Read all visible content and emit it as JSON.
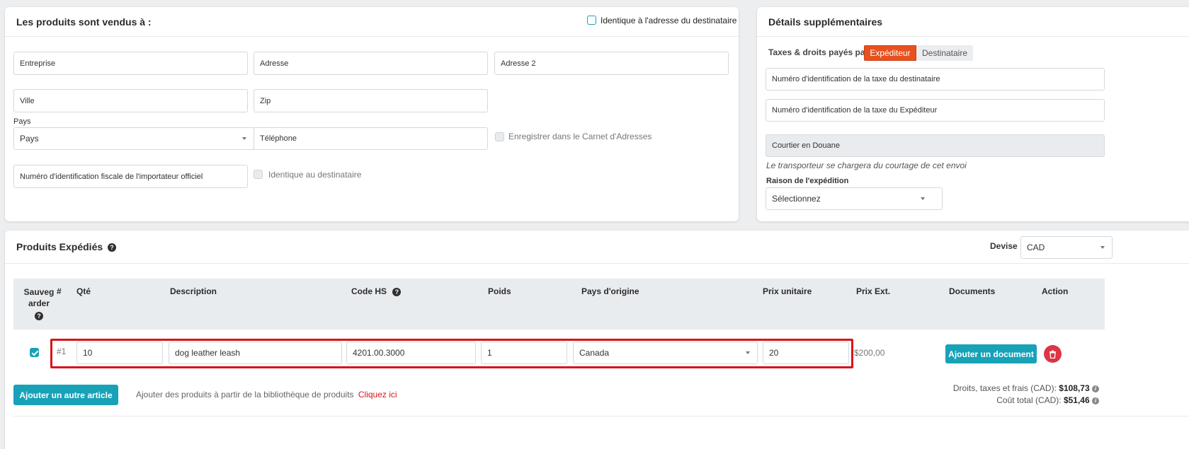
{
  "sold_to": {
    "title": "Les produits sont vendus à :",
    "same_as_recipient_label": "Identique à l'adresse du destinataire",
    "company_placeholder": "Entreprise",
    "address_placeholder": "Adresse",
    "address2_placeholder": "Adresse 2",
    "city_placeholder": "Ville",
    "zip_placeholder": "Zip",
    "country_label": "Pays",
    "country_placeholder": "Pays",
    "phone_placeholder": "Téléphone",
    "save_addressbook_label": "Enregistrer dans le Carnet d'Adresses",
    "importer_tax_placeholder": "Numéro d'identification fiscale de l'importateur officiel",
    "same_as_dest_label": "Identique au destinataire"
  },
  "details": {
    "title": "Détails supplémentaires",
    "taxes_paid_by_label": "Taxes & droits payés par",
    "sender_option": "Expéditeur",
    "recipient_option": "Destinataire",
    "recipient_tax_placeholder": "Numéro d'identification de la taxe du destinataire",
    "sender_tax_placeholder": "Numéro d'identification de la taxe du Expéditeur",
    "broker_value": "Courtier en Douane",
    "broker_note": "Le transporteur se chargera du courtage de cet envoi",
    "reason_label": "Raison de l'expédition",
    "reason_value": "Sélectionnez"
  },
  "products": {
    "title": "Produits Expédiés",
    "currency_label": "Devise",
    "currency_value": "CAD",
    "columns": {
      "save_line1": "Sauveg",
      "save_line2": "arder",
      "number": "#",
      "qty": "Qté",
      "description": "Description",
      "hs_code": "Code HS",
      "weight": "Poids",
      "origin": "Pays d'origine",
      "unit_price": "Prix unitaire",
      "ext_price": "Prix Ext.",
      "documents": "Documents",
      "action": "Action"
    },
    "rows": [
      {
        "number": "#1",
        "qty": "10",
        "description": "dog leather leash",
        "hs_code": "4201.00.3000",
        "weight": "1",
        "origin": "Canada",
        "unit_price": "20",
        "ext_price": "$200,00",
        "add_doc_label": "Ajouter un document"
      }
    ],
    "add_item_label": "Ajouter un autre article",
    "library_text": "Ajouter des produits à partir de la bibliothèque de produits",
    "library_link": "Cliquez ici",
    "duties_label": "Droits, taxes et frais (CAD):",
    "duties_value": "$108,73",
    "total_label": "Coût total (CAD):",
    "total_value": "$51,46"
  },
  "colors": {
    "accent_orange": "#e8501e",
    "teal": "#17a2b8",
    "danger": "#dc3545",
    "highlight_red": "#d9141b"
  }
}
